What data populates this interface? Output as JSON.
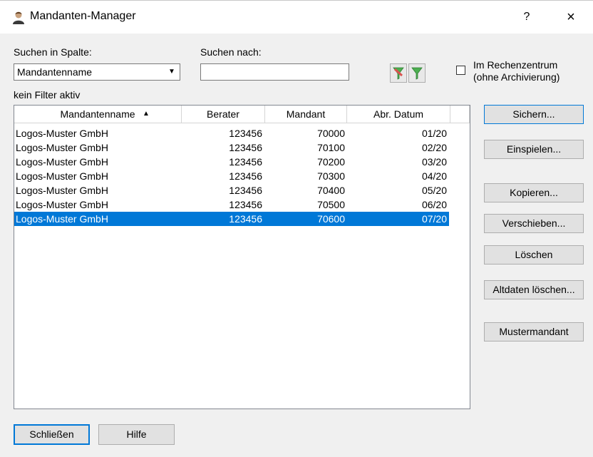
{
  "window": {
    "title": "Mandanten-Manager",
    "help_label": "?",
    "close_label": "×"
  },
  "search": {
    "column_label": "Suchen in Spalte:",
    "column_value": "Mandantenname",
    "term_label": "Suchen nach:",
    "term_value": "",
    "filter_status": "kein Filter aktiv"
  },
  "options": {
    "rechenzentrum_label_1": "Im Rechenzentrum",
    "rechenzentrum_label_2": "(ohne Archivierung)",
    "rechenzentrum_checked": false
  },
  "table": {
    "columns": [
      "Mandantenname",
      "Berater",
      "Mandant",
      "Abr. Datum"
    ],
    "sort_indicator": "▲",
    "rows": [
      {
        "name": "Logos-Muster GmbH",
        "berater": "123456",
        "mandant": "70000",
        "datum": "01/20"
      },
      {
        "name": "Logos-Muster GmbH",
        "berater": "123456",
        "mandant": "70100",
        "datum": "02/20"
      },
      {
        "name": "Logos-Muster GmbH",
        "berater": "123456",
        "mandant": "70200",
        "datum": "03/20"
      },
      {
        "name": "Logos-Muster GmbH",
        "berater": "123456",
        "mandant": "70300",
        "datum": "04/20"
      },
      {
        "name": "Logos-Muster GmbH",
        "berater": "123456",
        "mandant": "70400",
        "datum": "05/20"
      },
      {
        "name": "Logos-Muster GmbH",
        "berater": "123456",
        "mandant": "70500",
        "datum": "06/20"
      },
      {
        "name": "Logos-Muster GmbH",
        "berater": "123456",
        "mandant": "70600",
        "datum": "07/20"
      }
    ],
    "selected_row": 6
  },
  "side_buttons": {
    "sichern": "Sichern...",
    "einspielen": "Einspielen...",
    "kopieren": "Kopieren...",
    "verschieben": "Verschieben...",
    "loeschen": "Löschen",
    "altdaten": "Altdaten löschen...",
    "mustermandant": "Mustermandant"
  },
  "bottom_buttons": {
    "schliessen": "Schließen",
    "hilfe": "Hilfe"
  },
  "colors": {
    "accent": "#0078d7",
    "selection": "#0078d7",
    "filter_red": "#d9534f",
    "filter_green": "#4caf50"
  }
}
